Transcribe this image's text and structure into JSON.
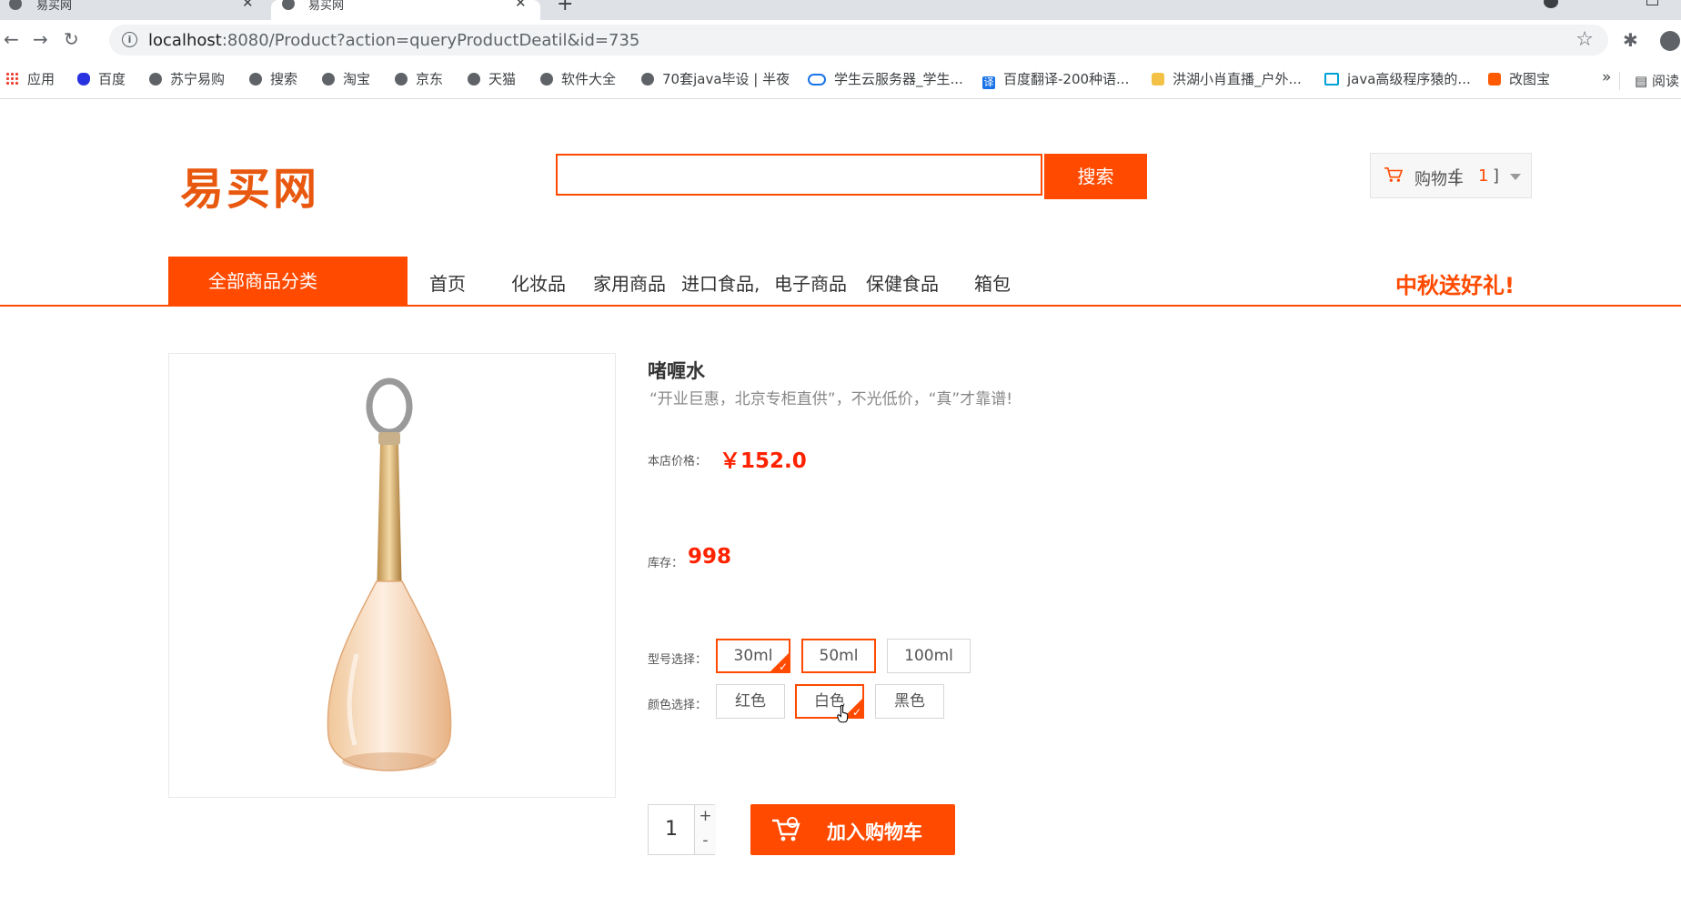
{
  "browser": {
    "tabs": [
      {
        "title": "易买网"
      },
      {
        "title": "易买网"
      }
    ],
    "address": {
      "host": "localhost",
      "rest": ":8080/Product?action=queryProductDeatil&id=735"
    },
    "bookmarks": [
      {
        "label": "应用",
        "icon": "apps-grid-icon"
      },
      {
        "label": "百度",
        "icon": "baidu-icon"
      },
      {
        "label": "苏宁易购",
        "icon": "globe-icon"
      },
      {
        "label": "搜索",
        "icon": "globe-icon"
      },
      {
        "label": "淘宝",
        "icon": "globe-icon"
      },
      {
        "label": "京东",
        "icon": "globe-icon"
      },
      {
        "label": "天猫",
        "icon": "globe-icon"
      },
      {
        "label": "软件大全",
        "icon": "globe-icon"
      },
      {
        "label": "70套java毕设 | 半夜",
        "icon": "globe-icon"
      },
      {
        "label": "学生云服务器_学生...",
        "icon": "cloud-icon"
      },
      {
        "label": "百度翻译-200种语...",
        "icon": "translate-icon"
      },
      {
        "label": "洪湖小肖直播_户外...",
        "icon": "live-icon"
      },
      {
        "label": "java高级程序猿的...",
        "icon": "bilibili-icon"
      },
      {
        "label": "改图宝",
        "icon": "gaitubao-icon"
      }
    ],
    "bookmarks_more": "»",
    "reading_list": "阅读"
  },
  "header": {
    "logo": "易买网",
    "search_value": "",
    "search_button": "搜索",
    "cart": {
      "label": "购物车",
      "open": "[",
      "count": "1",
      "close": "]"
    }
  },
  "nav": {
    "all_categories": "全部商品分类",
    "items": [
      "首页",
      "化妆品",
      "家用商品",
      "进口食品,",
      "电子商品",
      "保健食品",
      "箱包"
    ],
    "promo": "中秋送好礼!"
  },
  "product": {
    "name": "啫喱水",
    "description": "“开业巨惠，北京专柜直供”，不光低价，“真”才靠谱!",
    "price_label": "本店价格：",
    "price": "￥152.0",
    "stock_label": "库存：",
    "stock": "998",
    "model_label": "型号选择：",
    "models": [
      {
        "label": "30ml",
        "selected": true
      },
      {
        "label": "50ml",
        "selected": false
      },
      {
        "label": "100ml",
        "selected": false
      }
    ],
    "color_label": "颜色选择：",
    "colors": [
      {
        "label": "红色",
        "selected": false
      },
      {
        "label": "白色",
        "selected": true
      },
      {
        "label": "黑色",
        "selected": false
      }
    ],
    "quantity": "1",
    "qty_plus": "+",
    "qty_minus": "-",
    "add_to_cart": "加入购物车"
  },
  "colors": {
    "accent": "#ff4a00",
    "price": "#ff2200"
  }
}
